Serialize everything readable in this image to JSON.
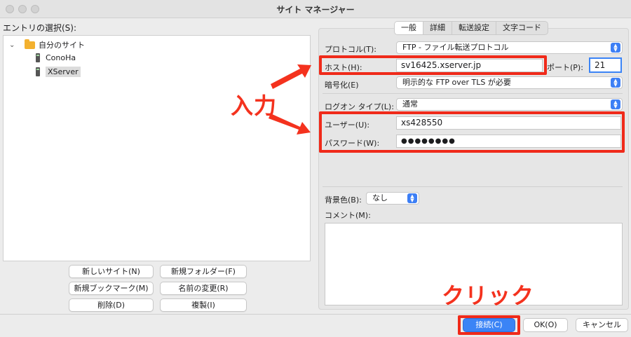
{
  "window": {
    "title": "サイト マネージャー",
    "traffic_lights": [
      "close",
      "minimize",
      "zoom"
    ]
  },
  "entries": {
    "label": "エントリの選択(S):",
    "folder": {
      "label": "自分のサイト",
      "expanded": true
    },
    "sites": [
      {
        "label": "ConoHa",
        "selected": false
      },
      {
        "label": "XServer",
        "selected": true
      }
    ]
  },
  "left_buttons": {
    "new_site": "新しいサイト(N)",
    "new_folder": "新規フォルダー(F)",
    "new_bookmark": "新規ブックマーク(M)",
    "rename": "名前の変更(R)",
    "delete": "削除(D)",
    "duplicate": "複製(I)"
  },
  "tabs": [
    {
      "label": "一般",
      "active": true
    },
    {
      "label": "詳細",
      "active": false
    },
    {
      "label": "転送設定",
      "active": false
    },
    {
      "label": "文字コード",
      "active": false
    }
  ],
  "form": {
    "protocol": {
      "label": "プロトコル(T):",
      "value": "FTP - ファイル転送プロトコル"
    },
    "host": {
      "label": "ホスト(H):",
      "value": "sv16425.xserver.jp"
    },
    "port": {
      "label": "ポート(P):",
      "value": "21"
    },
    "encryption": {
      "label": "暗号化(E)",
      "value": "明示的な FTP over TLS が必要"
    },
    "logon_type": {
      "label": "ログオン タイプ(L):",
      "value": "通常"
    },
    "user": {
      "label": "ユーザー(U):",
      "value": "xs428550"
    },
    "password": {
      "label": "パスワード(W):",
      "value": "●●●●●●●●"
    },
    "background": {
      "label": "背景色(B):",
      "value": "なし"
    },
    "comment": {
      "label": "コメント(M):",
      "value": ""
    }
  },
  "annotations": {
    "input": "入力",
    "click": "クリック",
    "color": "#f02a1a"
  },
  "footer": {
    "connect": "接続(C)",
    "ok": "OK(O)",
    "cancel": "キャンセル"
  },
  "colors": {
    "accent": "#3b84f6",
    "folder": "#f3b12f"
  }
}
